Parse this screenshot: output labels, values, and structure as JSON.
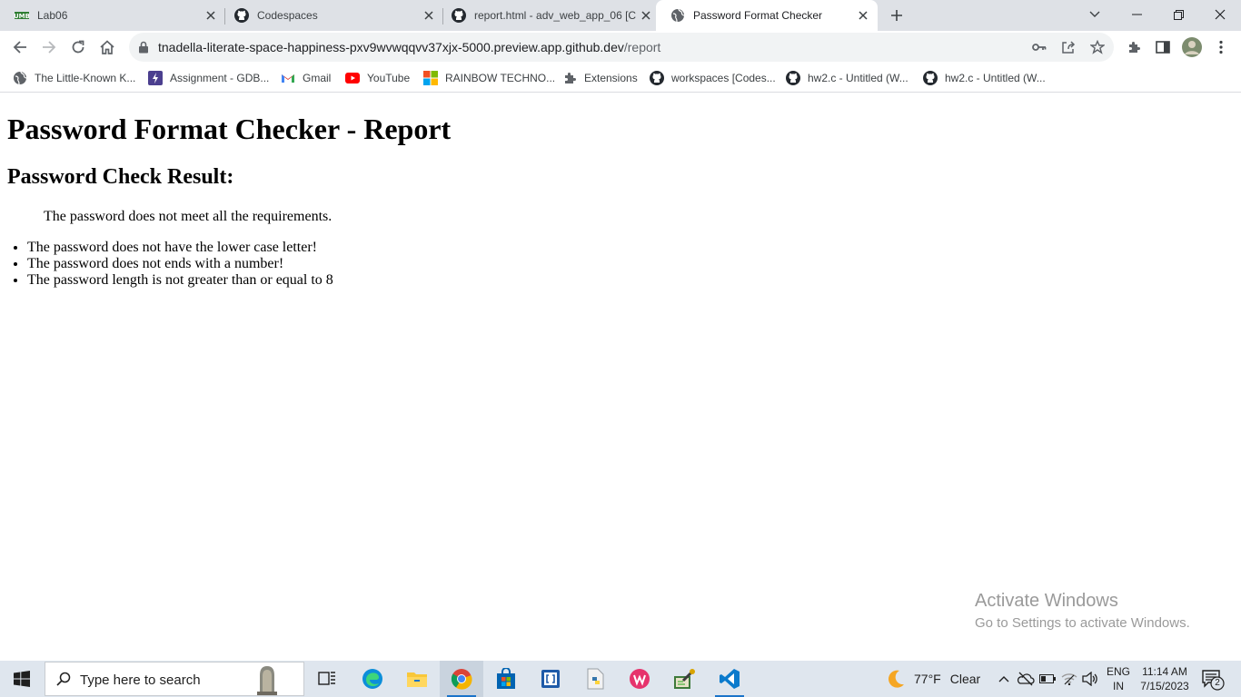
{
  "browser": {
    "tabs": [
      {
        "title": "Lab06",
        "icon": "umb-favicon"
      },
      {
        "title": "Codespaces",
        "icon": "github-icon"
      },
      {
        "title": "report.html - adv_web_app_06 [C",
        "icon": "github-icon"
      },
      {
        "title": "Password Format Checker",
        "icon": "globe-icon",
        "active": true
      }
    ],
    "url": {
      "host": "tnadella-literate-space-happiness-pxv9wvwqqvv37xjx-5000.preview.app.github.dev",
      "path": "/report"
    },
    "bookmarks": [
      {
        "label": "The Little-Known K...",
        "icon": "globe-icon"
      },
      {
        "label": "Assignment - GDB...",
        "icon": "gdb-icon"
      },
      {
        "label": "Gmail",
        "icon": "gmail-icon"
      },
      {
        "label": "YouTube",
        "icon": "youtube-icon"
      },
      {
        "label": "RAINBOW TECHNO...",
        "icon": "microsoft-icon"
      },
      {
        "label": "Extensions",
        "icon": "puzzle-icon"
      },
      {
        "label": "workspaces [Codes...",
        "icon": "github-icon"
      },
      {
        "label": "hw2.c - Untitled (W...",
        "icon": "github-icon"
      },
      {
        "label": "hw2.c - Untitled (W...",
        "icon": "github-icon"
      }
    ]
  },
  "page": {
    "title": "Password Format Checker - Report",
    "subtitle": "Password Check Result:",
    "result": "The password does not meet all the requirements.",
    "errors": [
      "The password does not have the lower case letter!",
      "The password does not ends with a number!",
      "The password length is not greater than or equal to 8"
    ]
  },
  "watermark": {
    "line1": "Activate Windows",
    "line2": "Go to Settings to activate Windows."
  },
  "taskbar": {
    "search_placeholder": "Type here to search",
    "weather": {
      "temp": "77°F",
      "condition": "Clear"
    },
    "language": {
      "line1": "ENG",
      "line2": "IN"
    },
    "clock": {
      "time": "11:14 AM",
      "date": "7/15/2023"
    },
    "notification_count": "2"
  },
  "colors": {
    "tab_strip": "#dee1e6",
    "omnibox": "#f1f3f4",
    "taskbar": "#dfe6ee",
    "vscode_blue": "#0a7acc"
  }
}
